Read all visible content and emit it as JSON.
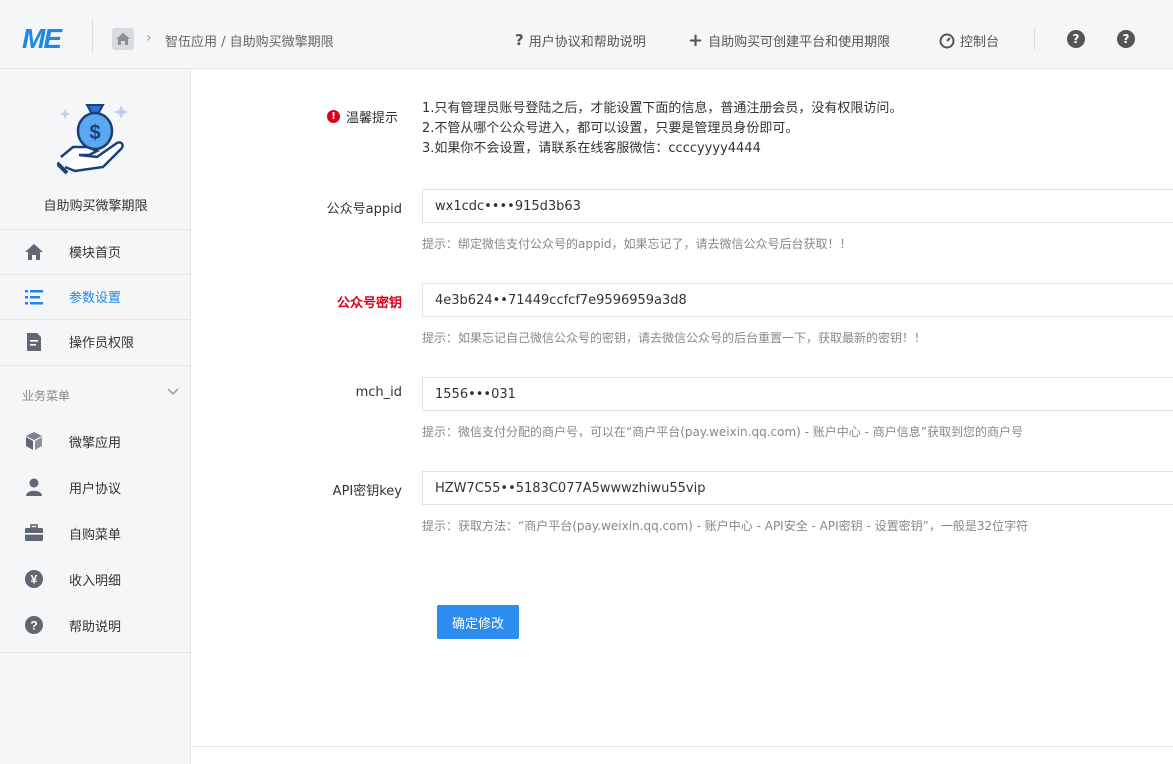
{
  "header": {
    "logo": "ME",
    "breadcrumb_sep": "›",
    "breadcrumb": "智伍应用 / 自助购买微擎期限",
    "links": [
      {
        "icon": "question-icon",
        "label": "用户协议和帮助说明"
      },
      {
        "icon": "plus-icon",
        "label": "自助购买可创建平台和使用期限"
      },
      {
        "icon": "gauge-icon",
        "label": "控制台"
      }
    ],
    "help_glyph": "?"
  },
  "sidebar": {
    "app_name": "自助购买微擎期限",
    "items": [
      {
        "label": "模块首页",
        "icon": "home-icon"
      },
      {
        "label": "参数设置",
        "icon": "list-icon",
        "active": true
      },
      {
        "label": "操作员权限",
        "icon": "document-icon"
      }
    ],
    "section_title": "业务菜单",
    "business_items": [
      {
        "label": "微擎应用",
        "icon": "cubes-icon"
      },
      {
        "label": "用户协议",
        "icon": "user-icon"
      },
      {
        "label": "自购菜单",
        "icon": "toolbox-icon"
      },
      {
        "label": "收入明细",
        "icon": "yen-icon"
      },
      {
        "label": "帮助说明",
        "icon": "help-circle-icon"
      }
    ]
  },
  "form": {
    "tip_label": "温馨提示",
    "tip_glyph": "!",
    "tips": [
      "1.只有管理员账号登陆之后，才能设置下面的信息，普通注册会员，没有权限访问。",
      "2.不管从哪个公众号进入，都可以设置，只要是管理员身份即可。",
      "3.如果你不会设置，请联系在线客服微信：ccccyyyy4444"
    ],
    "fields": [
      {
        "label": "公众号appid",
        "value": "wx1cdc••••915d3b63",
        "hint": "提示：绑定微信支付公众号的appid，如果忘记了，请去微信公众号后台获取！！"
      },
      {
        "label": "公众号密钥",
        "value": "4e3b624••71449ccfcf7e9596959a3d8",
        "hint": "提示：如果忘记自己微信公众号的密钥，请去微信公众号的后台重置一下，获取最新的密钥！！"
      },
      {
        "label": "mch_id",
        "value": "1556•••031",
        "hint": "提示：微信支付分配的商户号，可以在“商户平台(pay.weixin.qq.com) - 账户中心 - 商户信息”获取到您的商户号"
      },
      {
        "label": "API密钥key",
        "value": "HZW7C55••5183C077A5wwwzhiwu55vip",
        "hint": "提示：获取方法：“商户平台(pay.weixin.qq.com) - 账户中心 - API安全 - API密钥 - 设置密钥”，一般是32位字符"
      }
    ],
    "submit_label": "确定修改"
  },
  "colors": {
    "accent": "#1e88e5",
    "button": "#2d8cf0",
    "required": "#d9001b"
  }
}
